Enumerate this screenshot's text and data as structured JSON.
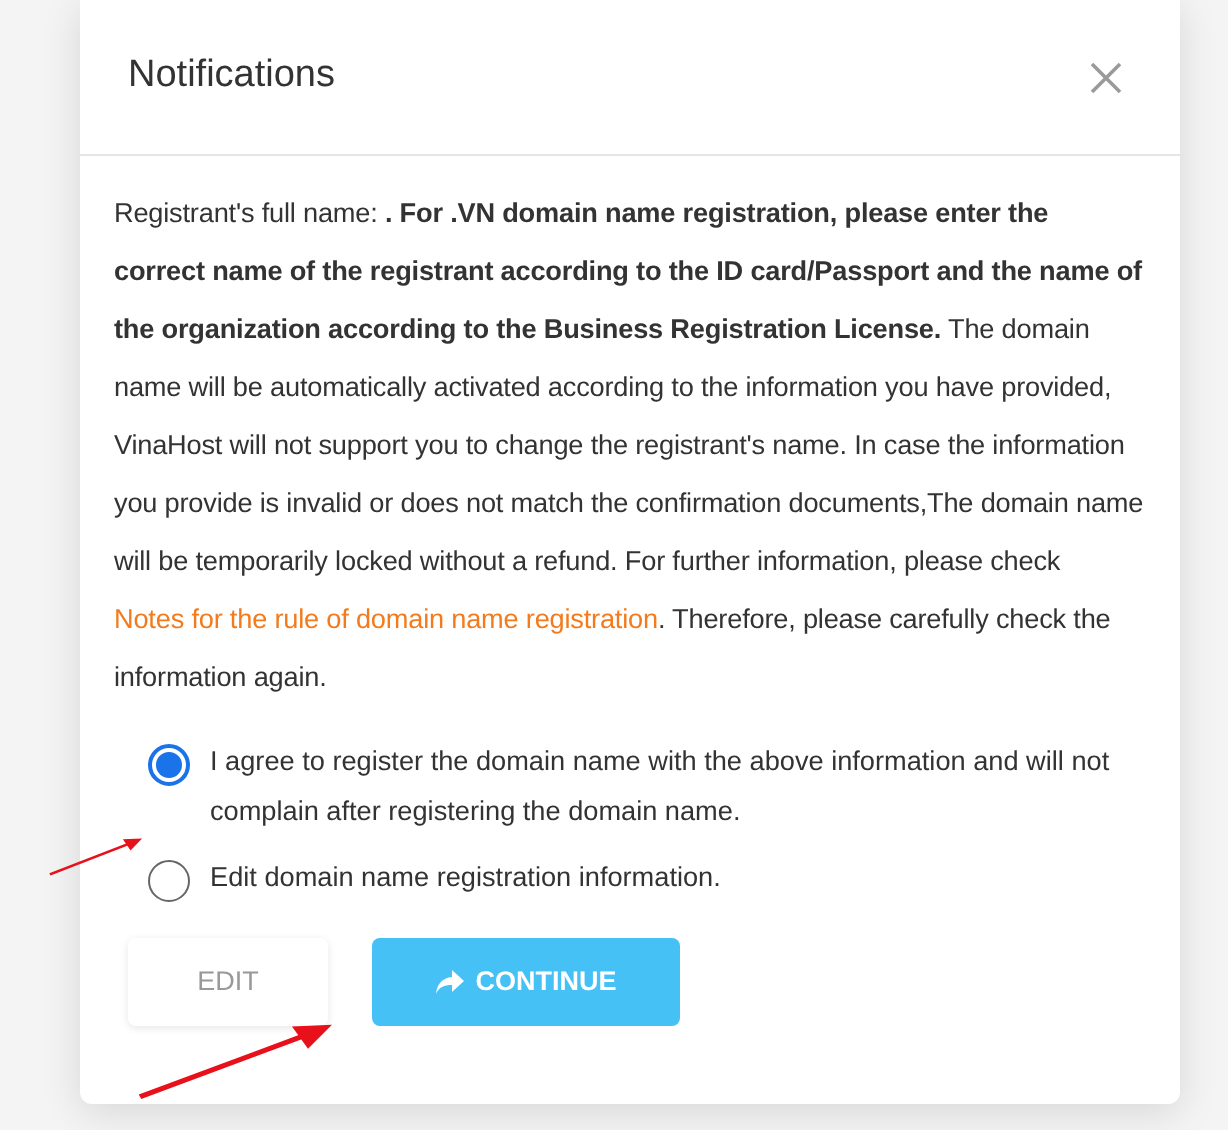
{
  "dialog": {
    "title": "Notifications",
    "message": {
      "before": "Registrant's full name: **. For .VN domain name registration, please enter the correct name of the registrant according to the ID card/Passport and the name of the organization according to the Business Registration License.** The domain name will be automatically activated according to the information you have provided, VinaHost will not support you to change the registrant's name. In case the information you provide is invalid or does not match the confirmation documents,The domain name will be temporarily locked without a refund. For further information, please check ",
      "link": "Notes for the rule of domain name registration",
      "after": ". Therefore, please carefully check the information again."
    },
    "options": [
      {
        "label": "I agree to register the domain name with the above information and will not complain after registering the domain name.",
        "selected": true
      },
      {
        "label": "Edit domain name registration information.",
        "selected": false
      }
    ],
    "buttons": [
      {
        "label": "EDIT",
        "kind": "secondary"
      },
      {
        "label": "CONTINUE",
        "kind": "primary"
      }
    ]
  }
}
